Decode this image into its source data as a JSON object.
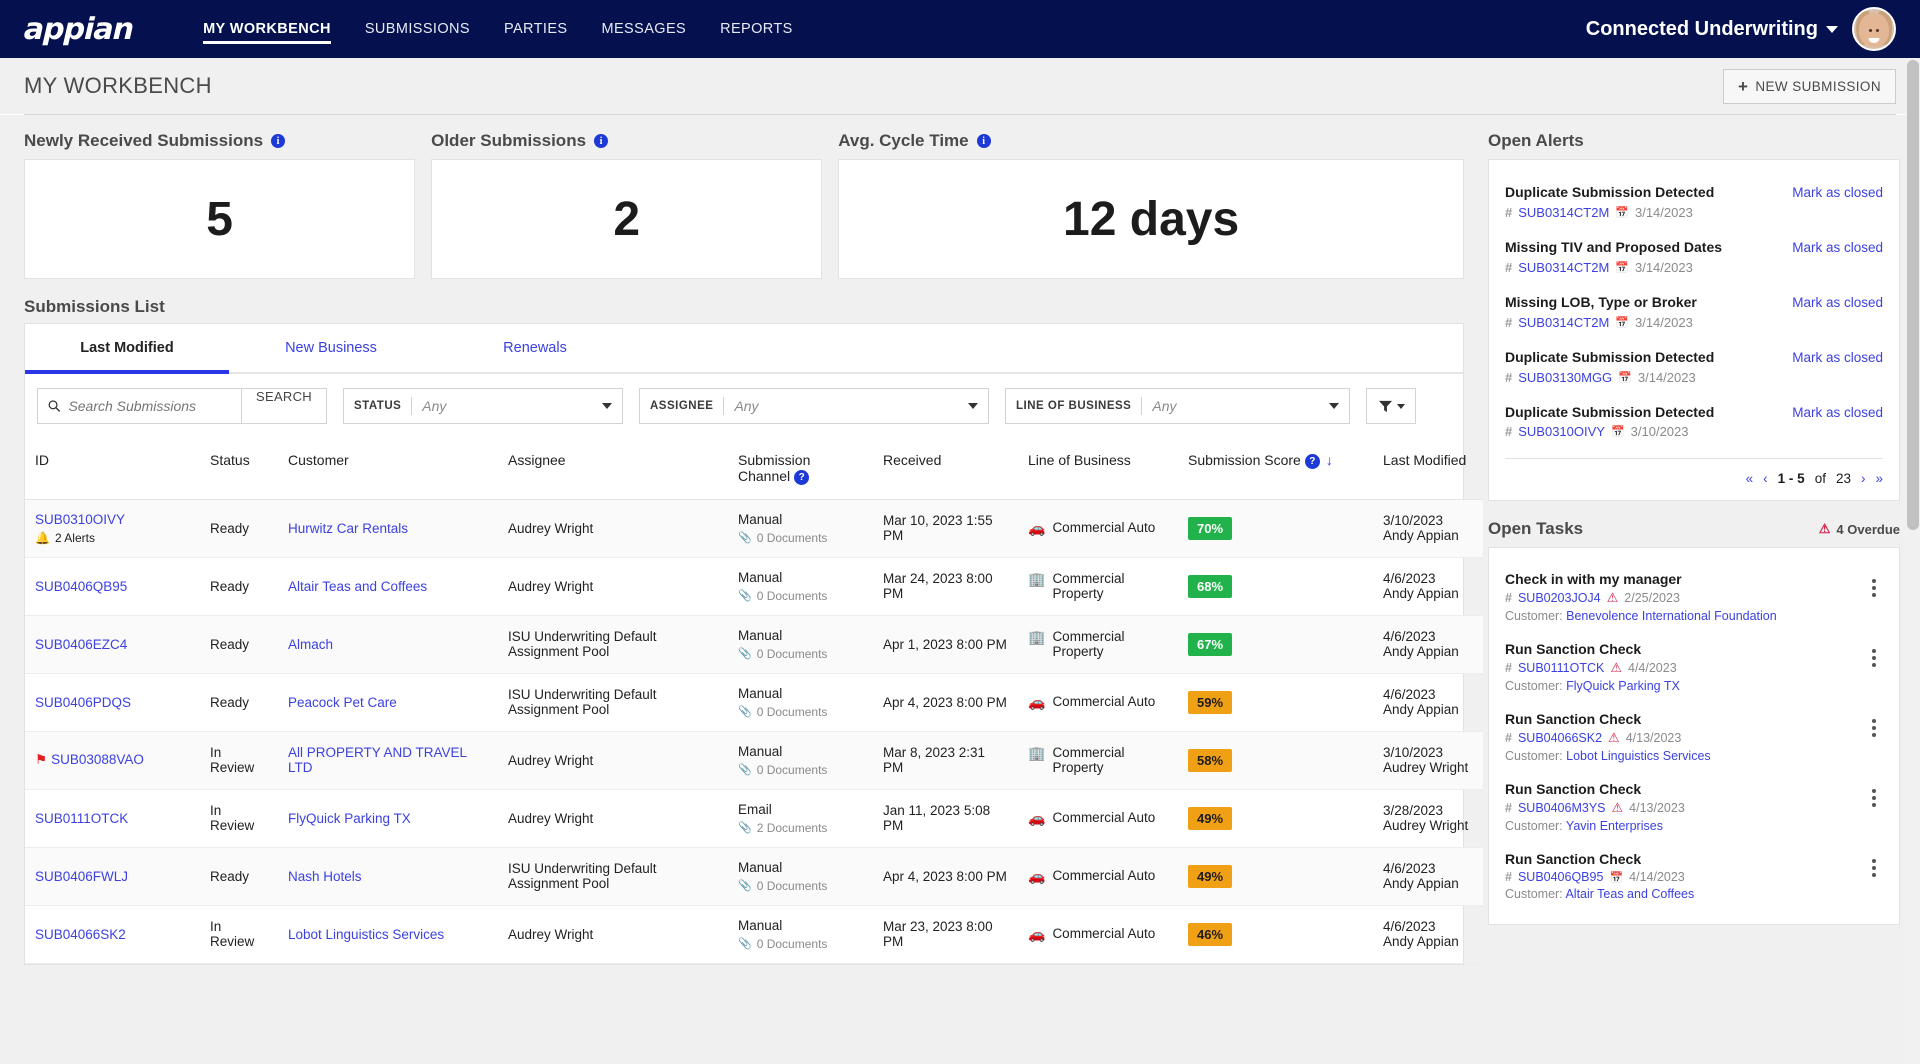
{
  "topnav": {
    "logo": "appian",
    "items": [
      {
        "label": "MY WORKBENCH",
        "active": true
      },
      {
        "label": "SUBMISSIONS",
        "active": false
      },
      {
        "label": "PARTIES",
        "active": false
      },
      {
        "label": "MESSAGES",
        "active": false
      },
      {
        "label": "REPORTS",
        "active": false
      }
    ],
    "user": "Connected Underwriting",
    "brand_color": "#04114e"
  },
  "page": {
    "title": "MY WORKBENCH",
    "new_submission": "NEW SUBMISSION",
    "new_submission_plus": "+"
  },
  "kpis": [
    {
      "label": "Newly Received Submissions",
      "value": "5"
    },
    {
      "label": "Older Submissions",
      "value": "2"
    },
    {
      "label": "Avg. Cycle Time",
      "value": "12 days"
    }
  ],
  "submissions": {
    "section_title": "Submissions List",
    "tabs": [
      {
        "label": "Last Modified",
        "active": true
      },
      {
        "label": "New Business",
        "active": false
      },
      {
        "label": "Renewals",
        "active": false
      }
    ],
    "search_placeholder": "Search Submissions",
    "search_value": "",
    "search_button": "SEARCH",
    "filters": [
      {
        "label": "STATUS",
        "value": "Any"
      },
      {
        "label": "ASSIGNEE",
        "value": "Any"
      },
      {
        "label": "LINE OF BUSINESS",
        "value": "Any"
      }
    ],
    "columns": [
      "ID",
      "Status",
      "Customer",
      "Assignee",
      "Submission Channel",
      "Received",
      "Line of Business",
      "Submission Score",
      "Last Modified"
    ],
    "sorted_column": "Submission Score",
    "sort_direction": "desc",
    "rows": [
      {
        "id": "SUB0310OIVY",
        "flagged": false,
        "alerts": "2 Alerts",
        "status": "Ready",
        "customer": "Hurwitz Car Rentals",
        "assignee": "Audrey Wright",
        "channel": "Manual",
        "documents": "0 Documents",
        "received": "Mar 10, 2023 1:55 PM",
        "lob": "Commercial Auto",
        "lob_icon": "car-icon",
        "score": "70%",
        "score_tone": "green",
        "modified_date": "3/10/2023",
        "modified_by": "Andy Appian"
      },
      {
        "id": "SUB0406QB95",
        "flagged": false,
        "alerts": "",
        "status": "Ready",
        "customer": "Altair Teas and Coffees",
        "assignee": "Audrey Wright",
        "channel": "Manual",
        "documents": "0 Documents",
        "received": "Mar 24, 2023 8:00 PM",
        "lob": "Commercial Property",
        "lob_icon": "building-icon",
        "score": "68%",
        "score_tone": "green",
        "modified_date": "4/6/2023",
        "modified_by": "Andy Appian"
      },
      {
        "id": "SUB0406EZC4",
        "flagged": false,
        "alerts": "",
        "status": "Ready",
        "customer": "Almach",
        "assignee": "ISU Underwriting Default Assignment Pool",
        "channel": "Manual",
        "documents": "0 Documents",
        "received": "Apr 1, 2023 8:00 PM",
        "lob": "Commercial Property",
        "lob_icon": "building-icon",
        "score": "67%",
        "score_tone": "green",
        "modified_date": "4/6/2023",
        "modified_by": "Andy Appian"
      },
      {
        "id": "SUB0406PDQS",
        "flagged": false,
        "alerts": "",
        "status": "Ready",
        "customer": "Peacock Pet Care",
        "assignee": "ISU Underwriting Default Assignment Pool",
        "channel": "Manual",
        "documents": "0 Documents",
        "received": "Apr 4, 2023 8:00 PM",
        "lob": "Commercial Auto",
        "lob_icon": "car-icon",
        "score": "59%",
        "score_tone": "orange",
        "modified_date": "4/6/2023",
        "modified_by": "Andy Appian"
      },
      {
        "id": "SUB03088VAO",
        "flagged": true,
        "alerts": "",
        "status": "In Review",
        "customer": "All PROPERTY AND TRAVEL LTD",
        "assignee": "Audrey Wright",
        "channel": "Manual",
        "documents": "0 Documents",
        "received": "Mar 8, 2023 2:31 PM",
        "lob": "Commercial Property",
        "lob_icon": "building-icon",
        "score": "58%",
        "score_tone": "orange",
        "modified_date": "3/10/2023",
        "modified_by": "Audrey Wright"
      },
      {
        "id": "SUB0111OTCK",
        "flagged": false,
        "alerts": "",
        "status": "In Review",
        "customer": "FlyQuick Parking TX",
        "assignee": "Audrey Wright",
        "channel": "Email",
        "documents": "2 Documents",
        "received": "Jan 11, 2023 5:08 PM",
        "lob": "Commercial Auto",
        "lob_icon": "car-icon",
        "score": "49%",
        "score_tone": "orange",
        "modified_date": "3/28/2023",
        "modified_by": "Audrey Wright"
      },
      {
        "id": "SUB0406FWLJ",
        "flagged": false,
        "alerts": "",
        "status": "Ready",
        "customer": "Nash Hotels",
        "assignee": "ISU Underwriting Default Assignment Pool",
        "channel": "Manual",
        "documents": "0 Documents",
        "received": "Apr 4, 2023 8:00 PM",
        "lob": "Commercial Auto",
        "lob_icon": "car-icon",
        "score": "49%",
        "score_tone": "orange",
        "modified_date": "4/6/2023",
        "modified_by": "Andy Appian"
      },
      {
        "id": "SUB04066SK2",
        "flagged": false,
        "alerts": "",
        "status": "In Review",
        "customer": "Lobot Linguistics Services",
        "assignee": "Audrey Wright",
        "channel": "Manual",
        "documents": "0 Documents",
        "received": "Mar 23, 2023 8:00 PM",
        "lob": "Commercial Auto",
        "lob_icon": "car-icon",
        "score": "46%",
        "score_tone": "orange",
        "modified_date": "4/6/2023",
        "modified_by": "Andy Appian"
      }
    ]
  },
  "open_alerts": {
    "title": "Open Alerts",
    "mark_label": "Mark as closed",
    "items": [
      {
        "title": "Duplicate Submission Detected",
        "id": "SUB0314CT2M",
        "date": "3/14/2023"
      },
      {
        "title": "Missing TIV and Proposed Dates",
        "id": "SUB0314CT2M",
        "date": "3/14/2023"
      },
      {
        "title": "Missing LOB, Type or Broker",
        "id": "SUB0314CT2M",
        "date": "3/14/2023"
      },
      {
        "title": "Duplicate Submission Detected",
        "id": "SUB03130MGG",
        "date": "3/14/2023"
      },
      {
        "title": "Duplicate Submission Detected",
        "id": "SUB0310OIVY",
        "date": "3/10/2023"
      }
    ],
    "pager": {
      "range": "1 - 5",
      "of": "of",
      "total": "23"
    }
  },
  "open_tasks": {
    "title": "Open Tasks",
    "overdue": "4 Overdue",
    "customer_label": "Customer:",
    "items": [
      {
        "title": "Check in with my manager",
        "id": "SUB0203JOJ4",
        "date": "2/25/2023",
        "overdue": true,
        "customer": "Benevolence International Foundation"
      },
      {
        "title": "Run Sanction Check",
        "id": "SUB0111OTCK",
        "date": "4/4/2023",
        "overdue": true,
        "customer": "FlyQuick Parking TX"
      },
      {
        "title": "Run Sanction Check",
        "id": "SUB04066SK2",
        "date": "4/13/2023",
        "overdue": true,
        "customer": "Lobot Linguistics Services"
      },
      {
        "title": "Run Sanction Check",
        "id": "SUB0406M3YS",
        "date": "4/13/2023",
        "overdue": true,
        "customer": "Yavin Enterprises"
      },
      {
        "title": "Run Sanction Check",
        "id": "SUB0406QB95",
        "date": "4/14/2023",
        "overdue": false,
        "customer": "Altair Teas and Coffees"
      }
    ]
  }
}
